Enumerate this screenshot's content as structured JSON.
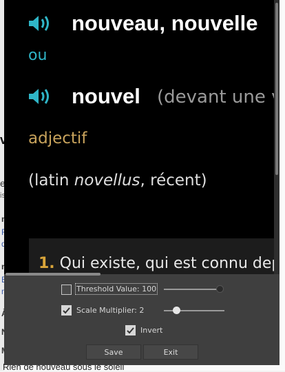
{
  "background_page": {
    "fragments": [
      "vi",
      "ea",
      "is",
      "n",
      "F",
      "d",
      "n",
      "E",
      "n",
      "À",
      "N",
      "M"
    ],
    "bottom_line": "Rien de nouveau sous le soleil"
  },
  "dictionary": {
    "headword_main": "nouveau, nouvelle",
    "ou": "ou",
    "headword_alt": "nouvel",
    "alt_note": "(devant une voyelle ou un h muet)",
    "part_of_speech": "adjectif",
    "etymology_prefix": "(latin ",
    "etymology_word": "novellus",
    "etymology_suffix": ", récent)",
    "definition_number": "1.",
    "definition_text": "Qui existe, qui est connu depuis peu"
  },
  "controls": {
    "threshold": {
      "label": "Threshold Value: 100",
      "checked": false,
      "value": 100
    },
    "scale": {
      "label": "Scale Multiplier: 2",
      "checked": true,
      "value": 2
    },
    "invert": {
      "label": "Invert",
      "checked": true
    },
    "save_label": "Save",
    "exit_label": "Exit"
  },
  "colors": {
    "speaker_icon": "#2fb6c8",
    "headword": "#ffffff",
    "part_of_speech": "#c8a35c",
    "definition_number": "#d9a53a"
  },
  "icons": [
    "speaker-icon",
    "checkmark-icon"
  ]
}
